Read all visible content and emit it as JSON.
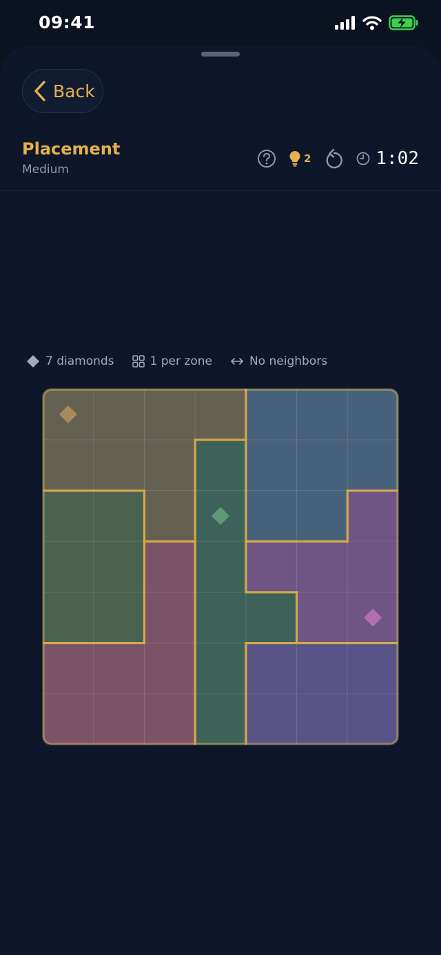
{
  "status_bar": {
    "time": "09:41"
  },
  "header": {
    "back_label": "Back",
    "title": "Placement",
    "difficulty": "Medium",
    "hint_count": "2",
    "timer": "1:02"
  },
  "rules": {
    "count": "7 diamonds",
    "per_zone": "1 per zone",
    "neighbors": "No neighbors"
  },
  "colors": {
    "accent": "#e6b04e",
    "background": "#0b1321",
    "zone_border": "#d4a84a"
  },
  "board": {
    "size": 7,
    "zones": [
      [
        0,
        0,
        0,
        0,
        1,
        1,
        1
      ],
      [
        0,
        0,
        0,
        2,
        1,
        1,
        1
      ],
      [
        3,
        3,
        0,
        2,
        1,
        1,
        4
      ],
      [
        3,
        3,
        5,
        2,
        4,
        4,
        4
      ],
      [
        3,
        3,
        5,
        2,
        2,
        4,
        4
      ],
      [
        5,
        5,
        5,
        2,
        6,
        6,
        6
      ],
      [
        5,
        5,
        5,
        2,
        6,
        6,
        6
      ]
    ],
    "zone_colors": [
      "#646152",
      "#47627a",
      "#3d6259",
      "#4a6250",
      "#6e5585",
      "#7a5466",
      "#585487"
    ],
    "diamonds": [
      {
        "row": 0,
        "col": 0,
        "color": "#a88a5c"
      },
      {
        "row": 2,
        "col": 3,
        "color": "#5e9a76"
      },
      {
        "row": 4,
        "col": 6,
        "color": "#b26fb0"
      }
    ]
  }
}
